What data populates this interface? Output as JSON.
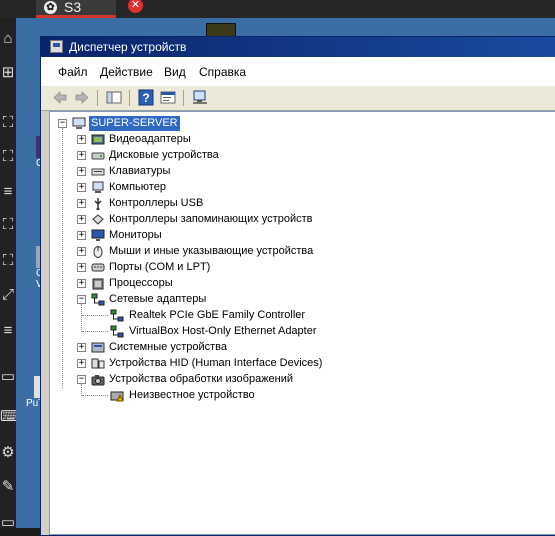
{
  "viewer": {
    "tab_label": "S3",
    "close_glyph": "✕",
    "tab_icon_glyph": "✿"
  },
  "window": {
    "title": "Диспетчер устройств"
  },
  "menu": {
    "file": "Файл",
    "action": "Действие",
    "view": "Вид",
    "help": "Справка"
  },
  "tree": {
    "root": "SUPER-SERVER",
    "categories": [
      {
        "label": "Видеоадаптеры",
        "icon": "display-adapter-icon",
        "expanded": false
      },
      {
        "label": "Дисковые устройства",
        "icon": "disk-drive-icon",
        "expanded": false
      },
      {
        "label": "Клавиатуры",
        "icon": "keyboard-icon",
        "expanded": false
      },
      {
        "label": "Компьютер",
        "icon": "computer-icon",
        "expanded": false
      },
      {
        "label": "Контроллеры USB",
        "icon": "usb-icon",
        "expanded": false
      },
      {
        "label": "Контроллеры запоминающих устройств",
        "icon": "storage-controller-icon",
        "expanded": false
      },
      {
        "label": "Мониторы",
        "icon": "monitor-icon",
        "expanded": false
      },
      {
        "label": "Мыши и иные указывающие устройства",
        "icon": "mouse-icon",
        "expanded": false
      },
      {
        "label": "Порты (COM и LPT)",
        "icon": "port-icon",
        "expanded": false
      },
      {
        "label": "Процессоры",
        "icon": "processor-icon",
        "expanded": false
      },
      {
        "label": "Сетевые адаптеры",
        "icon": "network-adapter-icon",
        "expanded": true,
        "children": [
          "Realtek PCIe GbE Family Controller",
          "VirtualBox Host-Only Ethernet Adapter"
        ]
      },
      {
        "label": "Системные устройства",
        "icon": "system-device-icon",
        "expanded": false
      },
      {
        "label": "Устройства HID (Human Interface Devices)",
        "icon": "hid-icon",
        "expanded": false
      },
      {
        "label": "Устройства обработки изображений",
        "icon": "imaging-device-icon",
        "expanded": true,
        "children": [
          "Неизвестное устройство"
        ]
      }
    ]
  },
  "desktop_labels": {
    "icon1": "CP",
    "icon2a": "C",
    "icon2b": "V",
    "icon3": "PuT"
  },
  "colors": {
    "titlebar": "#0a246a",
    "selection": "#316ac5",
    "viewer_accent": "#d3372b",
    "desktop": "#3a6ea5"
  }
}
